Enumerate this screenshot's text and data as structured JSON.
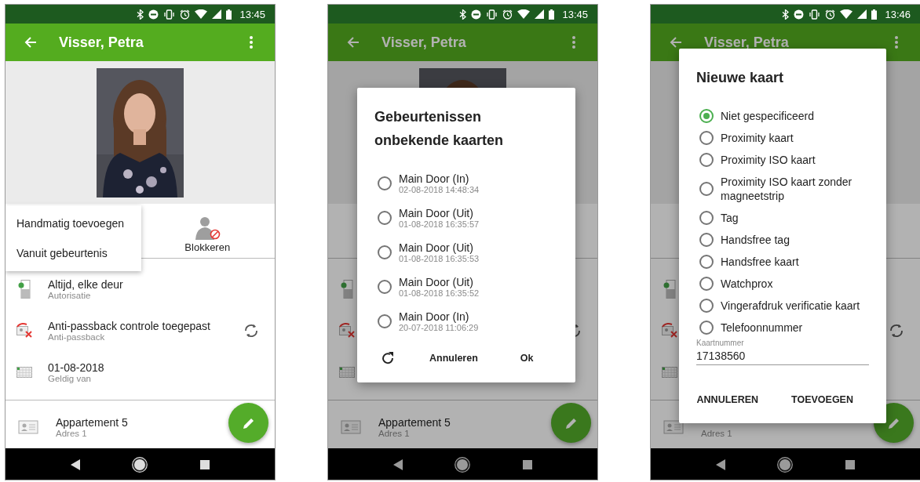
{
  "screens": [
    {
      "status_bar": {
        "time": "13:45"
      },
      "app_bar": {
        "title": "Visser, Petra"
      },
      "photo": {
        "kind": "picture"
      },
      "actions": [
        {
          "label": "Blokkeren"
        }
      ],
      "popup_menu": {
        "items": [
          "Handmatig toevoegen",
          "Vanuit gebeurtenis"
        ]
      },
      "rows": [
        {
          "kind": "authorization",
          "title": "Altijd, elke deur",
          "subtitle": "Autorisatie"
        },
        {
          "kind": "antipassback",
          "title": "Anti-passback controle toegepast",
          "subtitle": "Anti-passback"
        },
        {
          "kind": "calendar",
          "title": "01-08-2018",
          "subtitle": "Geldig van"
        }
      ],
      "address": {
        "title": "Appartement 5",
        "subtitle": "Adres 1"
      }
    },
    {
      "status_bar": {
        "time": "13:45"
      },
      "app_bar": {
        "title": "Visser, Petra"
      },
      "photo": {
        "kind": "picture"
      },
      "rows": [
        {
          "kind": "authorization"
        },
        {
          "kind": "antipassback"
        },
        {
          "kind": "calendar"
        }
      ],
      "address": {
        "title": "Appartement 5",
        "subtitle": "Adres 1"
      },
      "dialog": {
        "kind": "events",
        "title": "Gebeurtenissen onbekende kaarten",
        "options": [
          {
            "label": "Main Door (In)",
            "time": "02-08-2018 14:48:34",
            "selected": false
          },
          {
            "label": "Main Door (Uit)",
            "time": "01-08-2018 16:35:57",
            "selected": false
          },
          {
            "label": "Main Door (Uit)",
            "time": "01-08-2018 16:35:53",
            "selected": false
          },
          {
            "label": "Main Door (Uit)",
            "time": "01-08-2018 16:35:52",
            "selected": false
          },
          {
            "label": "Main Door (In)",
            "time": "20-07-2018 11:06:29",
            "selected": false
          }
        ],
        "buttons": [
          "Annuleren",
          "Ok"
        ]
      }
    },
    {
      "status_bar": {
        "time": "13:46"
      },
      "app_bar": {
        "title": "Visser, Petra"
      },
      "rows": [
        {
          "kind": "authorization"
        },
        {
          "kind": "antipassback"
        },
        {
          "kind": "calendar"
        }
      ],
      "address": {
        "subtitle": "Adres 1"
      },
      "dialog": {
        "kind": "new_card",
        "title": "Nieuwe kaart",
        "options": [
          {
            "label": "Niet gespecificeerd",
            "selected": true
          },
          {
            "label": "Proximity kaart",
            "selected": false
          },
          {
            "label": "Proximity ISO kaart",
            "selected": false
          },
          {
            "label": "Proximity ISO kaart zonder magneetstrip",
            "selected": false
          },
          {
            "label": "Tag",
            "selected": false
          },
          {
            "label": "Handsfree tag",
            "selected": false
          },
          {
            "label": "Handsfree kaart",
            "selected": false
          },
          {
            "label": "Watchprox",
            "selected": false
          },
          {
            "label": "Vingerafdruk verificatie kaart",
            "selected": false
          },
          {
            "label": "Telefoonnummer",
            "selected": false
          }
        ],
        "field": {
          "label": "Kaartnummer",
          "value": "17138560"
        },
        "buttons": [
          "ANNULEREN",
          "TOEVOEGEN"
        ]
      }
    }
  ]
}
